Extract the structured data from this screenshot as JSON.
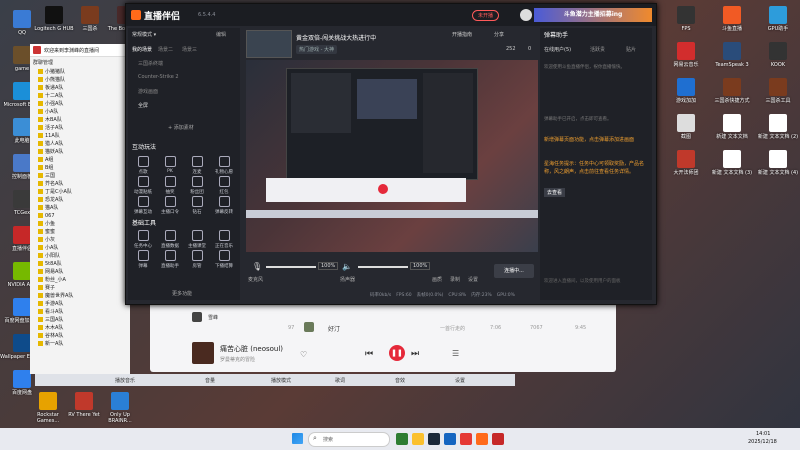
{
  "desktop_left_icons": [
    {
      "label": "QQ",
      "icon": "qq-icon",
      "color": "#3a7bd5"
    },
    {
      "label": "game",
      "icon": "folder-icon",
      "color": "#6b4f2a"
    },
    {
      "label": "Microsoft Edge",
      "icon": "edge-icon",
      "color": "#1b8fd8"
    },
    {
      "label": "此电脑",
      "icon": "computer-icon",
      "color": "#3b8ed6"
    },
    {
      "label": "控制面板",
      "icon": "control-panel-icon",
      "color": "#4a79c8"
    },
    {
      "label": "TCGex",
      "icon": "app-icon",
      "color": "#3a3a3a"
    },
    {
      "label": "直播伴侣",
      "icon": "live-icon",
      "color": "#c62828"
    },
    {
      "label": "NVIDIA App",
      "icon": "nvidia-icon",
      "color": "#76b900"
    },
    {
      "label": "百度网盘加速版",
      "icon": "cloud-icon",
      "color": "#2f80ed"
    },
    {
      "label": "Wallpaper Engine",
      "icon": "wallpaper-icon",
      "color": "#0e4b8a"
    },
    {
      "label": "百度网盘",
      "icon": "baidu-icon",
      "color": "#2f80ed"
    }
  ],
  "desktop_top_icons": [
    {
      "label": "Logitech G HUB",
      "color": "#111111"
    },
    {
      "label": "三国杀",
      "color": "#7a3b1e"
    },
    {
      "label": "The Boneroom",
      "color": "#4a2a2a"
    }
  ],
  "desktop_bottom_icons": [
    {
      "label": "Rockstar Games...",
      "color": "#e7a200"
    },
    {
      "label": "RV There Yet",
      "color": "#c0392b"
    },
    {
      "label": "Only Up BRAINR...",
      "color": "#2a7fd6"
    }
  ],
  "desktop_right_icons": [
    {
      "label": "FPS",
      "color": "#333333"
    },
    {
      "label": "斗鱼直播",
      "color": "#f15a24"
    },
    {
      "label": "GPU助手",
      "color": "#2d9cdb"
    },
    {
      "label": "网易云音乐",
      "color": "#d22d2d"
    },
    {
      "label": "TeamSpeak 3",
      "color": "#2a4c7a"
    },
    {
      "label": "KOOK",
      "color": "#333333"
    },
    {
      "label": "游戏加加",
      "color": "#1f6fd1"
    },
    {
      "label": "三国杀快捷方式",
      "color": "#7a3b1e"
    },
    {
      "label": "三国杀工具",
      "color": "#7a3b1e"
    },
    {
      "label": "截图",
      "color": "#dddddd"
    },
    {
      "label": "新建 文本文档",
      "color": "#ffffff"
    },
    {
      "label": "新建 文本文档 (2)",
      "color": "#ffffff"
    },
    {
      "label": "大开法师团",
      "color": "#c0392b"
    },
    {
      "label": "新建 文本文档 (3)",
      "color": "#ffffff"
    },
    {
      "label": "新建 文本文档 (4)",
      "color": "#ffffff"
    }
  ],
  "qq_window": {
    "header": "欢迎来到李渊峰的直播间",
    "tab": "群聊管理",
    "groups": [
      "小猪猪队",
      "小熊猫队",
      "板递A队",
      "十二A队",
      "小强A队",
      "小A队",
      "木BA队",
      "活子A队",
      "11A队",
      "猎人A队",
      "猫妖A队",
      "A组",
      "B组",
      "三国",
      "芥名A队",
      "丁是C小A队",
      "恐龙A队",
      "猫A队",
      "067",
      "小鱼",
      "蜜蜜",
      "小灰",
      "小A队",
      "小阳队",
      "5t8A队",
      "网易A队",
      "粉丝_小A",
      "赛子",
      "魔兽世界A队",
      "手游A队",
      "看斗A队",
      "三国A队",
      "木木A队",
      "谷林A队",
      "新一A队"
    ]
  },
  "zb_app": {
    "title": "直播伴侣",
    "version": "6.5.4.4",
    "live_status": "未开播",
    "top_actions": [
      "开播指南",
      "分享"
    ],
    "stream_title": "黄金双倍-闯关挑战大热进行中",
    "stream_sub": "热门游戏 - 大神",
    "stats": {
      "fans": "252",
      "likes": "0"
    },
    "scene_panel": {
      "mode_label": "常规模式",
      "edit_label": "编辑",
      "scene_tabs": [
        "我的场景",
        "场景二",
        "场景三"
      ],
      "sources": [
        "三国杀终端",
        "Counter-Strike 2",
        "游戏画面",
        "全屏"
      ],
      "add_source": "添加素材"
    },
    "interaction": {
      "title": "互动玩法",
      "items": [
        "点歌",
        "PK",
        "连麦",
        "礼物心愿",
        "动漫贴纸",
        "抽奖",
        "粉丝团",
        "红包",
        "弹幕互动",
        "主播口令",
        "钻石",
        "弹幕反转"
      ]
    },
    "tools": {
      "title": "基础工具",
      "items": [
        "任务中心",
        "直播数据",
        "主播课堂",
        "正在音乐",
        "弹幕",
        "直播助手",
        "房管",
        "下播结算"
      ],
      "more": "更多功能"
    },
    "audio": {
      "mic_label": "麦克风",
      "mic_volume": "100%",
      "speaker_label": "扬声器",
      "speaker_volume": "100%",
      "quality_label": "画质",
      "record_label": "录制",
      "settings_label": "设置",
      "start_button": "连播中..."
    },
    "status_bar": [
      "码率0kb/s",
      "FPS:60",
      "丢帧0(0.0%)",
      "CPU:8%",
      "内存:23%",
      "GPU:0%"
    ],
    "right_panel": {
      "title": "弹幕助手",
      "banner": "斗鱼潜力主播招募ing",
      "tabs": [
        "在线用户(5)",
        "活跃贵",
        "贴片"
      ],
      "notices": [
        "欢迎使用斗鱼直播伴侣，祝你直播愉快。",
        "弹幕助手已开启，点击即可查看。",
        "新增弹幕页面功能，点击弹幕添加进画面",
        "星海任务提示：任务中心可领取奖励，产品名称，风之朗声，点击前往查看任务详情。"
      ],
      "highlight_1": "新增弹幕页面功能，点击弹幕添加进画面",
      "highlight_2": "星海任务提示：任务中心可领取奖励，产品名称，风之朗声，点击前往查看任务详情。",
      "link": "去查看",
      "footer": "欢迎进入直播间，以及使用用户的面板"
    }
  },
  "music": {
    "rows": [
      {
        "title": "雪峰",
        "num": "",
        "extra": ""
      },
      {
        "title": "好汀",
        "num": "97",
        "extra": "一首行走的"
      }
    ],
    "row_meta": [
      "7:06",
      "7067",
      "9:45"
    ],
    "song_title": "痛苦心脏 (neosoul)",
    "artist": "罗曼蒂克的冒险",
    "toolbar": [
      "播放音乐",
      "音量",
      "播放模式",
      "歌词",
      "音效",
      "设置"
    ]
  },
  "taskbar": {
    "search_placeholder": "搜索",
    "time": "14:01",
    "date": "2025/12/18"
  }
}
